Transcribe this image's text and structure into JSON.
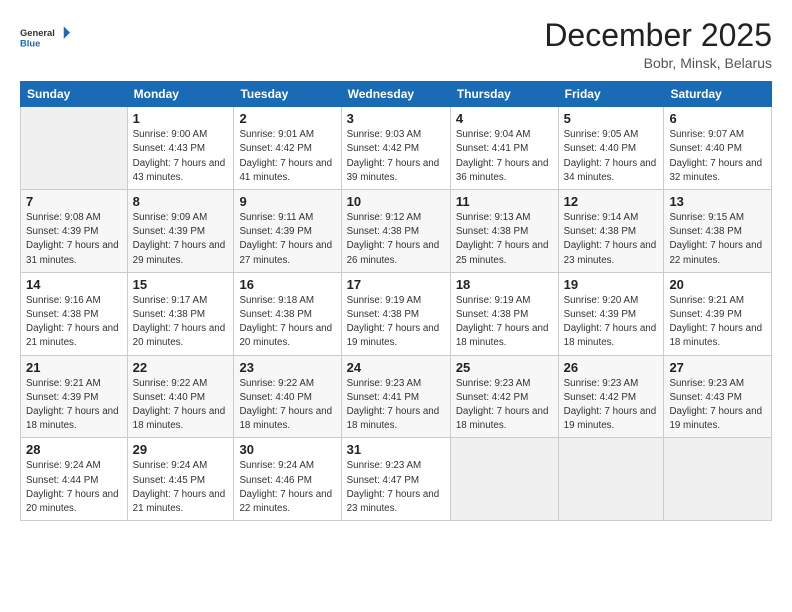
{
  "header": {
    "logo": {
      "general": "General",
      "blue": "Blue"
    },
    "title": "December 2025",
    "location": "Bobr, Minsk, Belarus"
  },
  "weekdays": [
    "Sunday",
    "Monday",
    "Tuesday",
    "Wednesday",
    "Thursday",
    "Friday",
    "Saturday"
  ],
  "weeks": [
    [
      {
        "day": "",
        "empty": true
      },
      {
        "day": "1",
        "sunrise": "Sunrise: 9:00 AM",
        "sunset": "Sunset: 4:43 PM",
        "daylight": "Daylight: 7 hours and 43 minutes."
      },
      {
        "day": "2",
        "sunrise": "Sunrise: 9:01 AM",
        "sunset": "Sunset: 4:42 PM",
        "daylight": "Daylight: 7 hours and 41 minutes."
      },
      {
        "day": "3",
        "sunrise": "Sunrise: 9:03 AM",
        "sunset": "Sunset: 4:42 PM",
        "daylight": "Daylight: 7 hours and 39 minutes."
      },
      {
        "day": "4",
        "sunrise": "Sunrise: 9:04 AM",
        "sunset": "Sunset: 4:41 PM",
        "daylight": "Daylight: 7 hours and 36 minutes."
      },
      {
        "day": "5",
        "sunrise": "Sunrise: 9:05 AM",
        "sunset": "Sunset: 4:40 PM",
        "daylight": "Daylight: 7 hours and 34 minutes."
      },
      {
        "day": "6",
        "sunrise": "Sunrise: 9:07 AM",
        "sunset": "Sunset: 4:40 PM",
        "daylight": "Daylight: 7 hours and 32 minutes."
      }
    ],
    [
      {
        "day": "7",
        "sunrise": "Sunrise: 9:08 AM",
        "sunset": "Sunset: 4:39 PM",
        "daylight": "Daylight: 7 hours and 31 minutes."
      },
      {
        "day": "8",
        "sunrise": "Sunrise: 9:09 AM",
        "sunset": "Sunset: 4:39 PM",
        "daylight": "Daylight: 7 hours and 29 minutes."
      },
      {
        "day": "9",
        "sunrise": "Sunrise: 9:11 AM",
        "sunset": "Sunset: 4:39 PM",
        "daylight": "Daylight: 7 hours and 27 minutes."
      },
      {
        "day": "10",
        "sunrise": "Sunrise: 9:12 AM",
        "sunset": "Sunset: 4:38 PM",
        "daylight": "Daylight: 7 hours and 26 minutes."
      },
      {
        "day": "11",
        "sunrise": "Sunrise: 9:13 AM",
        "sunset": "Sunset: 4:38 PM",
        "daylight": "Daylight: 7 hours and 25 minutes."
      },
      {
        "day": "12",
        "sunrise": "Sunrise: 9:14 AM",
        "sunset": "Sunset: 4:38 PM",
        "daylight": "Daylight: 7 hours and 23 minutes."
      },
      {
        "day": "13",
        "sunrise": "Sunrise: 9:15 AM",
        "sunset": "Sunset: 4:38 PM",
        "daylight": "Daylight: 7 hours and 22 minutes."
      }
    ],
    [
      {
        "day": "14",
        "sunrise": "Sunrise: 9:16 AM",
        "sunset": "Sunset: 4:38 PM",
        "daylight": "Daylight: 7 hours and 21 minutes."
      },
      {
        "day": "15",
        "sunrise": "Sunrise: 9:17 AM",
        "sunset": "Sunset: 4:38 PM",
        "daylight": "Daylight: 7 hours and 20 minutes."
      },
      {
        "day": "16",
        "sunrise": "Sunrise: 9:18 AM",
        "sunset": "Sunset: 4:38 PM",
        "daylight": "Daylight: 7 hours and 20 minutes."
      },
      {
        "day": "17",
        "sunrise": "Sunrise: 9:19 AM",
        "sunset": "Sunset: 4:38 PM",
        "daylight": "Daylight: 7 hours and 19 minutes."
      },
      {
        "day": "18",
        "sunrise": "Sunrise: 9:19 AM",
        "sunset": "Sunset: 4:38 PM",
        "daylight": "Daylight: 7 hours and 18 minutes."
      },
      {
        "day": "19",
        "sunrise": "Sunrise: 9:20 AM",
        "sunset": "Sunset: 4:39 PM",
        "daylight": "Daylight: 7 hours and 18 minutes."
      },
      {
        "day": "20",
        "sunrise": "Sunrise: 9:21 AM",
        "sunset": "Sunset: 4:39 PM",
        "daylight": "Daylight: 7 hours and 18 minutes."
      }
    ],
    [
      {
        "day": "21",
        "sunrise": "Sunrise: 9:21 AM",
        "sunset": "Sunset: 4:39 PM",
        "daylight": "Daylight: 7 hours and 18 minutes."
      },
      {
        "day": "22",
        "sunrise": "Sunrise: 9:22 AM",
        "sunset": "Sunset: 4:40 PM",
        "daylight": "Daylight: 7 hours and 18 minutes."
      },
      {
        "day": "23",
        "sunrise": "Sunrise: 9:22 AM",
        "sunset": "Sunset: 4:40 PM",
        "daylight": "Daylight: 7 hours and 18 minutes."
      },
      {
        "day": "24",
        "sunrise": "Sunrise: 9:23 AM",
        "sunset": "Sunset: 4:41 PM",
        "daylight": "Daylight: 7 hours and 18 minutes."
      },
      {
        "day": "25",
        "sunrise": "Sunrise: 9:23 AM",
        "sunset": "Sunset: 4:42 PM",
        "daylight": "Daylight: 7 hours and 18 minutes."
      },
      {
        "day": "26",
        "sunrise": "Sunrise: 9:23 AM",
        "sunset": "Sunset: 4:42 PM",
        "daylight": "Daylight: 7 hours and 19 minutes."
      },
      {
        "day": "27",
        "sunrise": "Sunrise: 9:23 AM",
        "sunset": "Sunset: 4:43 PM",
        "daylight": "Daylight: 7 hours and 19 minutes."
      }
    ],
    [
      {
        "day": "28",
        "sunrise": "Sunrise: 9:24 AM",
        "sunset": "Sunset: 4:44 PM",
        "daylight": "Daylight: 7 hours and 20 minutes."
      },
      {
        "day": "29",
        "sunrise": "Sunrise: 9:24 AM",
        "sunset": "Sunset: 4:45 PM",
        "daylight": "Daylight: 7 hours and 21 minutes."
      },
      {
        "day": "30",
        "sunrise": "Sunrise: 9:24 AM",
        "sunset": "Sunset: 4:46 PM",
        "daylight": "Daylight: 7 hours and 22 minutes."
      },
      {
        "day": "31",
        "sunrise": "Sunrise: 9:23 AM",
        "sunset": "Sunset: 4:47 PM",
        "daylight": "Daylight: 7 hours and 23 minutes."
      },
      {
        "day": "",
        "empty": true
      },
      {
        "day": "",
        "empty": true
      },
      {
        "day": "",
        "empty": true
      }
    ]
  ]
}
